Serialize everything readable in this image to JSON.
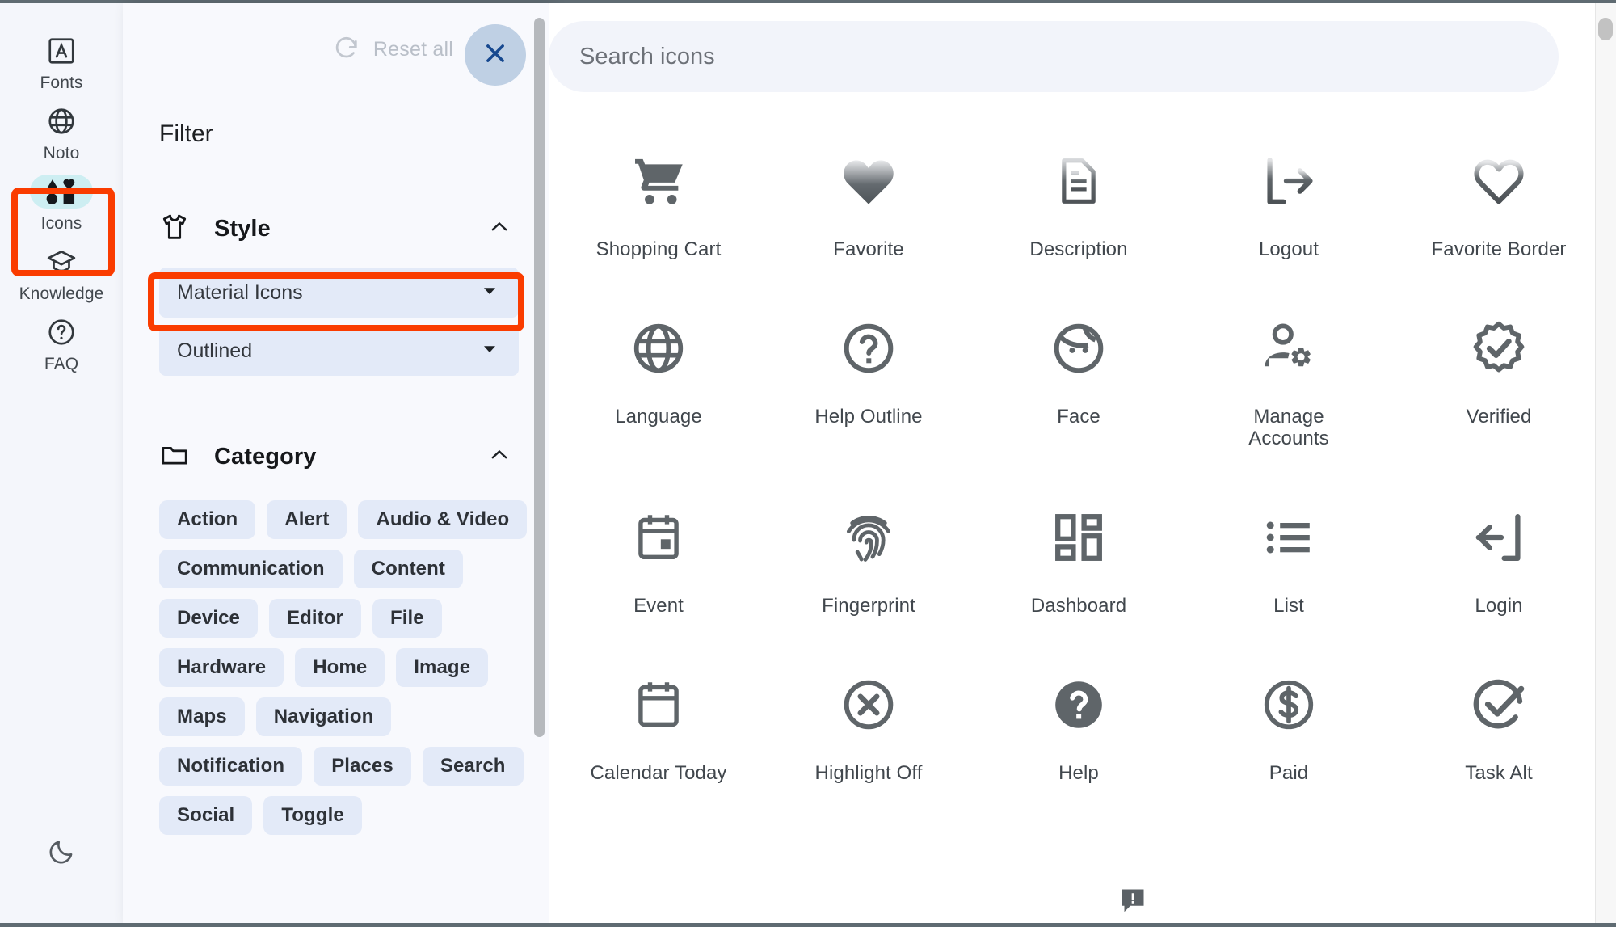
{
  "rail": {
    "items": [
      {
        "label": "Fonts",
        "icon": "font-square-icon",
        "active": false
      },
      {
        "label": "Noto",
        "icon": "globe-icon",
        "active": false
      },
      {
        "label": "Icons",
        "icon": "shapes-icon",
        "active": true
      },
      {
        "label": "Knowledge",
        "icon": "graduation-cap-icon",
        "active": false
      },
      {
        "label": "FAQ",
        "icon": "help-circle-icon",
        "active": false
      }
    ],
    "dark_mode_toggle": "moon-icon"
  },
  "panel": {
    "reset_label": "Reset all",
    "reset_icon": "refresh-icon",
    "close_icon": "close-icon",
    "title": "Filter",
    "style_section": {
      "title": "Style",
      "icon": "tshirt-icon",
      "collapse_icon": "chevron-up-icon",
      "dropdowns": [
        {
          "value": "Material Icons",
          "arrow": "chevron-down-icon",
          "highlighted": true
        },
        {
          "value": "Outlined",
          "arrow": "chevron-down-icon",
          "highlighted": false
        }
      ]
    },
    "category_section": {
      "title": "Category",
      "icon": "folder-icon",
      "collapse_icon": "chevron-up-icon",
      "chips": [
        "Action",
        "Alert",
        "Audio & Video",
        "Communication",
        "Content",
        "Device",
        "Editor",
        "File",
        "Hardware",
        "Home",
        "Image",
        "Maps",
        "Navigation",
        "Notification",
        "Places",
        "Search",
        "Social",
        "Toggle"
      ]
    },
    "scrollbar": "panel-scrollbar"
  },
  "main": {
    "search": {
      "placeholder": "Search icons"
    },
    "cart_icon": "shopping-bag-icon",
    "scroll_top_icon": "arrow-up-icon",
    "feedback_icon": "feedback-icon",
    "icons": [
      {
        "label": "Shopping Cart",
        "glyph": "shopping-cart-icon"
      },
      {
        "label": "Favorite",
        "glyph": "heart-filled-icon"
      },
      {
        "label": "Description",
        "glyph": "description-icon"
      },
      {
        "label": "Logout",
        "glyph": "logout-icon"
      },
      {
        "label": "Favorite Border",
        "glyph": "heart-outline-icon"
      },
      {
        "label": "Language",
        "glyph": "language-globe-icon"
      },
      {
        "label": "Help Outline",
        "glyph": "help-outline-icon"
      },
      {
        "label": "Face",
        "glyph": "face-icon"
      },
      {
        "label": "Manage Accounts",
        "glyph": "manage-accounts-icon"
      },
      {
        "label": "Verified",
        "glyph": "verified-icon"
      },
      {
        "label": "Event",
        "glyph": "event-calendar-icon"
      },
      {
        "label": "Fingerprint",
        "glyph": "fingerprint-icon"
      },
      {
        "label": "Dashboard",
        "glyph": "dashboard-icon"
      },
      {
        "label": "List",
        "glyph": "list-icon"
      },
      {
        "label": "Login",
        "glyph": "login-icon"
      },
      {
        "label": "Calendar Today",
        "glyph": "calendar-today-icon"
      },
      {
        "label": "Highlight Off",
        "glyph": "highlight-off-icon"
      },
      {
        "label": "Help",
        "glyph": "help-filled-icon"
      },
      {
        "label": "Paid",
        "glyph": "paid-dollar-icon"
      },
      {
        "label": "Task Alt",
        "glyph": "task-alt-icon"
      }
    ]
  },
  "colors": {
    "highlight": "#fa3c00",
    "rail_bg": "#f4f6fb",
    "panel_bg": "#f8f9fd",
    "chip_bg": "#e3eaf8",
    "active_pill": "#cdeef2",
    "close_bg": "#bfd0e4",
    "icon_fg": "#5f6569"
  }
}
